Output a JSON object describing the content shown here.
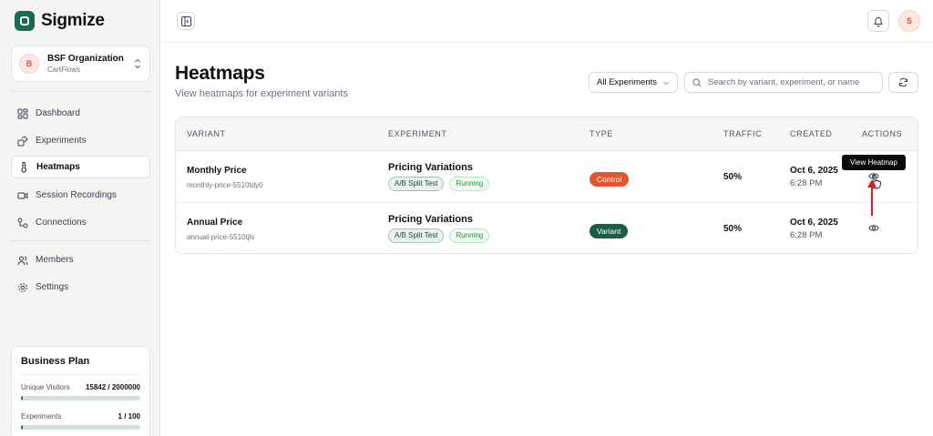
{
  "app": {
    "name": "Sigmize",
    "brand_color": "#1b6b4f",
    "accent_color": "#e2552f"
  },
  "org": {
    "initial": "B",
    "name": "BSF Organization",
    "subtitle": "CartFlows"
  },
  "nav": {
    "main": [
      {
        "label": "Dashboard",
        "icon": "dashboard-icon",
        "active": false
      },
      {
        "label": "Experiments",
        "icon": "experiments-icon",
        "active": false
      },
      {
        "label": "Heatmaps",
        "icon": "thermometer-icon",
        "active": true
      },
      {
        "label": "Session Recordings",
        "icon": "video-icon",
        "active": false
      },
      {
        "label": "Connections",
        "icon": "connections-icon",
        "active": false
      }
    ],
    "secondary": [
      {
        "label": "Members",
        "icon": "users-icon"
      },
      {
        "label": "Settings",
        "icon": "gear-icon"
      }
    ]
  },
  "plan": {
    "title": "Business Plan",
    "visitors_label": "Unique Visitors",
    "visitors_value": "15842 / 2000000",
    "visitors_fraction": 0.0079,
    "experiments_label": "Experiments",
    "experiments_value": "1 / 100",
    "experiments_fraction": 0.01
  },
  "topbar": {
    "user_initial": "S"
  },
  "page": {
    "title": "Heatmaps",
    "subtitle": "View heatmaps for experiment variants"
  },
  "filters": {
    "experiment_select": "All Experiments",
    "search_placeholder": "Search by variant, experiment, or name"
  },
  "table": {
    "headers": {
      "variant": "VARIANT",
      "experiment": "EXPERIMENT",
      "type": "TYPE",
      "traffic": "TRAFFIC",
      "created": "CREATED",
      "actions": "ACTIONS"
    },
    "rows": [
      {
        "variant": "Monthly Price",
        "slug": "monthly-price-5510tdy0",
        "experiment": "Pricing Variations",
        "tag1": "A/B Split Test",
        "tag2": "Running",
        "type": "Control",
        "type_color": "#e2552f",
        "traffic": "50%",
        "date": "Oct 6, 2025",
        "time": "6:28 PM"
      },
      {
        "variant": "Annual Price",
        "slug": "annual-price-5510tjls",
        "experiment": "Pricing Variations",
        "tag1": "A/B Split Test",
        "tag2": "Running",
        "type": "Variant",
        "type_color": "#1b5e46",
        "traffic": "50%",
        "date": "Oct 6, 2025",
        "time": "6:28 PM"
      }
    ]
  },
  "tooltip": {
    "text": "View Heatmap"
  }
}
